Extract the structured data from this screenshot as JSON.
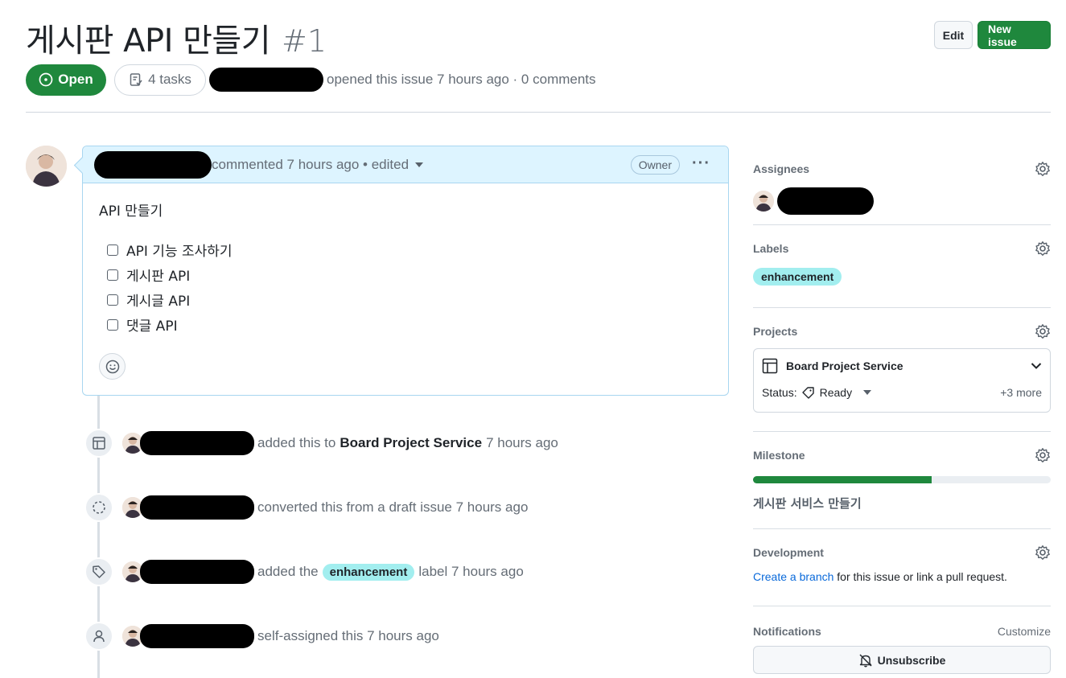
{
  "issue": {
    "title": "게시판 API 만들기",
    "number": "#1",
    "state": "Open",
    "tasks": "4 tasks",
    "meta": "opened this issue 7 hours ago · 0 comments"
  },
  "header": {
    "edit_label": "Edit",
    "new_issue_label": "New issue"
  },
  "comment": {
    "header_text": "commented 7 hours ago • edited",
    "owner_badge": "Owner",
    "body_title": "API 만들기",
    "tasks": [
      "API 기능 조사하기",
      "게시판 API",
      "게시글 API",
      "댓글 API"
    ]
  },
  "timeline": [
    {
      "icon": "table-icon",
      "text_before": "added this to",
      "bold": "Board Project Service",
      "text_after": "7 hours ago"
    },
    {
      "icon": "draft-issue-icon",
      "text": "converted this from a draft issue 7 hours ago"
    },
    {
      "icon": "tag-icon",
      "text_before": "added the",
      "label": "enhancement",
      "text_after": "label 7 hours ago"
    },
    {
      "icon": "person-icon",
      "text": "self-assigned this 7 hours ago"
    }
  ],
  "sidebar": {
    "assignees": {
      "heading": "Assignees"
    },
    "labels": {
      "heading": "Labels",
      "items": [
        "enhancement"
      ]
    },
    "projects": {
      "heading": "Projects",
      "name": "Board Project Service",
      "status_label": "Status:",
      "status_value": "Ready",
      "more": "+3 more"
    },
    "milestone": {
      "heading": "Milestone",
      "title": "게시판 서비스 만들기",
      "progress": 0.6
    },
    "development": {
      "heading": "Development",
      "link_text": "Create a branch",
      "rest_text": "for this issue or link a pull request."
    },
    "notifications": {
      "heading": "Notifications",
      "customize": "Customize",
      "unsubscribe": "Unsubscribe"
    }
  },
  "colors": {
    "open_green": "#1f883d",
    "label_enhancement": "#a2eeef",
    "comment_header": "#ddf4ff",
    "link": "#0969da"
  }
}
